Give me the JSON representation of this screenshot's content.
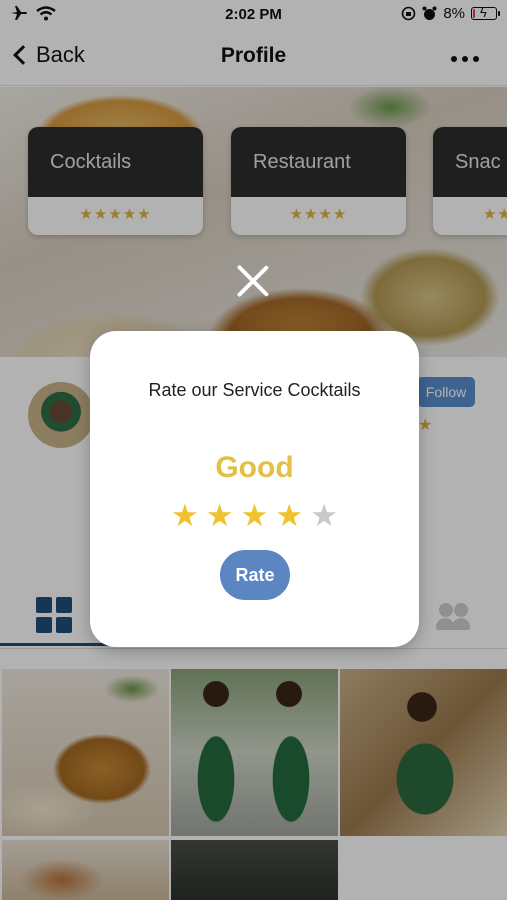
{
  "status_bar": {
    "time": "2:02 PM",
    "battery_percent": "8%",
    "battery_level": 0.08
  },
  "nav": {
    "back_label": "Back",
    "title": "Profile"
  },
  "rating_cards": [
    {
      "name": "Cocktails",
      "stars": "★★★★★"
    },
    {
      "name": "Restaurant",
      "stars": "★★★★"
    },
    {
      "name": "Snac",
      "stars": "★★"
    }
  ],
  "profile": {
    "follow_label": "Follow",
    "star_peek": "★"
  },
  "modal": {
    "prompt": "Rate our Service Cocktails",
    "verdict": "Good",
    "rating": 4,
    "max_rating": 5,
    "star_glyph": "★",
    "rate_label": "Rate"
  },
  "colors": {
    "accent_blue": "#5b86c1",
    "star_gold": "#f0c22e",
    "verdict_gold": "#e2bf45",
    "follow_blue": "#5a8fd0",
    "tab_blue": "#1f4e7a"
  }
}
